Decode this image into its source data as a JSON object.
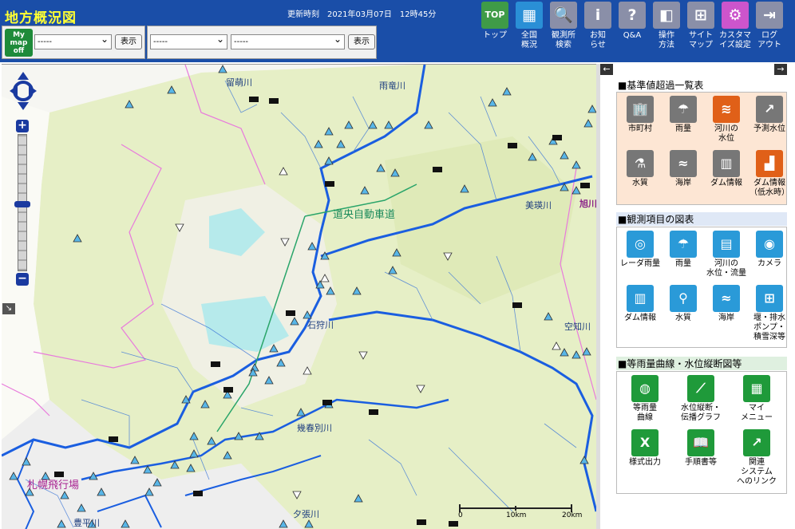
{
  "header": {
    "title": "地方概況図",
    "update_time": "更新時刻　2021年03月07日　12時45分",
    "mymap": {
      "btn_label": "My map off",
      "select_value": "-----",
      "show_label": "表示"
    },
    "station": {
      "select1_value": "-----",
      "select2_value": "-----",
      "show_label": "表示"
    }
  },
  "nav": [
    {
      "label": "トップ",
      "icon": "TOP",
      "color": "#3f9b47"
    },
    {
      "label": "全国\n概況",
      "icon": "▦",
      "color": "#2a8fd6"
    },
    {
      "label": "観測所\n検索",
      "icon": "🔍",
      "color": "#8a8fa8"
    },
    {
      "label": "お知\nらせ",
      "icon": "i",
      "color": "#8a8fa8"
    },
    {
      "label": "Q&A",
      "icon": "?",
      "color": "#8a8fa8"
    },
    {
      "label": "操作\n方法",
      "icon": "◧",
      "color": "#8a8fa8"
    },
    {
      "label": "サイト\nマップ",
      "icon": "⊞",
      "color": "#8a8fa8"
    },
    {
      "label": "カスタマ\nイズ設定",
      "icon": "⚙",
      "color": "#cc55cc"
    },
    {
      "label": "ログ\nアウト",
      "icon": "⇥",
      "color": "#8a8fa8"
    }
  ],
  "map_labels": {
    "rumoi_river": "留萌川",
    "uryu_river": "雨竜川",
    "expressway": "道央自動車道",
    "bibai_river": "美瑛川",
    "asahikawa": "旭川",
    "ishikari_river": "石狩川",
    "sorachi_river": "空知川",
    "chitose_river": "幾春別川",
    "yubari_river": "夕張川",
    "sapporo_airport": "札幌飛行場",
    "toyohira_river": "豊平川"
  },
  "scale": {
    "t0": "0",
    "t1": "10km",
    "t2": "20km"
  },
  "panel": {
    "section1": {
      "title": "■基準値超過一覧表",
      "items": [
        {
          "label": "市町村",
          "icon": "🏢",
          "color": "#777"
        },
        {
          "label": "雨量",
          "icon": "☂",
          "color": "#777"
        },
        {
          "label": "河川の\n水位",
          "icon": "≋",
          "color": "#e06018"
        },
        {
          "label": "予測水位",
          "icon": "↗",
          "color": "#777"
        },
        {
          "label": "水質",
          "icon": "⚗",
          "color": "#777"
        },
        {
          "label": "海岸",
          "icon": "≈",
          "color": "#777"
        },
        {
          "label": "ダム情報",
          "icon": "▥",
          "color": "#777"
        },
        {
          "label": "ダム情報\n（低水時）",
          "icon": "▟",
          "color": "#e06018"
        }
      ]
    },
    "section2": {
      "title": "■観測項目の図表",
      "items": [
        {
          "label": "レーダ雨量",
          "icon": "◎",
          "color": "#2a9ad8"
        },
        {
          "label": "雨量",
          "icon": "☂",
          "color": "#2a9ad8"
        },
        {
          "label": "河川の\n水位・流量",
          "icon": "▤",
          "color": "#2a9ad8"
        },
        {
          "label": "カメラ",
          "icon": "◉",
          "color": "#2a9ad8"
        },
        {
          "label": "ダム情報",
          "icon": "▥",
          "color": "#2a9ad8"
        },
        {
          "label": "水質",
          "icon": "⚲",
          "color": "#2a9ad8"
        },
        {
          "label": "海岸",
          "icon": "≈",
          "color": "#2a9ad8"
        },
        {
          "label": "堰・排水\nポンプ・\n積雪深等",
          "icon": "⊞",
          "color": "#2a9ad8"
        }
      ]
    },
    "section3": {
      "title": "■等雨量曲線・水位縦断図等",
      "items": [
        {
          "label": "等雨量\n曲線",
          "icon": "◍",
          "color": "#1f9a3a"
        },
        {
          "label": "水位縦断・\n伝播グラフ",
          "icon": "⟋",
          "color": "#1f9a3a"
        },
        {
          "label": "マイ\nメニュー",
          "icon": "▦",
          "color": "#1f9a3a"
        },
        {
          "label": "様式出力",
          "icon": "X",
          "color": "#1f9a3a"
        },
        {
          "label": "手順書等",
          "icon": "📖",
          "color": "#1f9a3a"
        },
        {
          "label": "関連\nシステム\nへのリンク",
          "icon": "↗",
          "color": "#1f9a3a"
        }
      ]
    }
  }
}
